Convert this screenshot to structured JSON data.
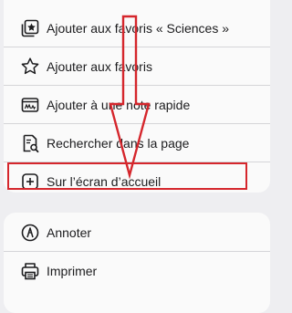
{
  "menu": {
    "items": [
      {
        "label": "Ajouter aux favoris « Sciences »",
        "icon": "favorites-folder-icon"
      },
      {
        "label": "Ajouter aux favoris",
        "icon": "star-icon"
      },
      {
        "label": "Ajouter à une note rapide",
        "icon": "quick-note-icon"
      },
      {
        "label": "Rechercher dans la page",
        "icon": "find-in-page-icon"
      },
      {
        "label": "Sur l’écran d’accueil",
        "icon": "add-square-icon"
      }
    ],
    "secondary_items": [
      {
        "label": "Annoter",
        "icon": "markup-pen-icon"
      },
      {
        "label": "Imprimer",
        "icon": "printer-icon"
      }
    ]
  },
  "annotation": {
    "color": "#d5262c",
    "highlighted_item": "Sur l’écran d’accueil"
  }
}
